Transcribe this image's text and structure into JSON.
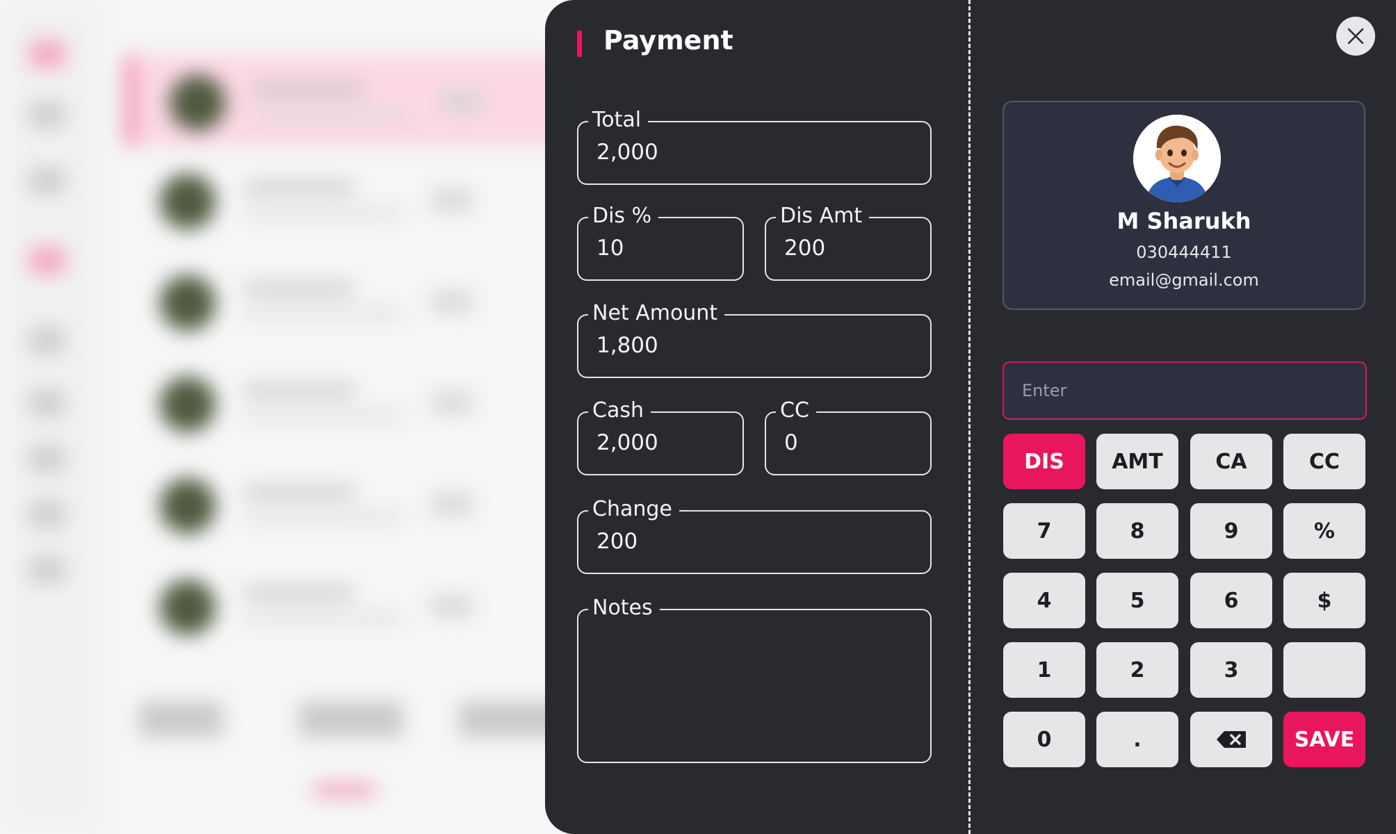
{
  "modal": {
    "title": "Payment",
    "close_icon": "close-icon"
  },
  "fields": {
    "total": {
      "label": "Total",
      "value": "2,000"
    },
    "dis_pct": {
      "label": "Dis %",
      "value": "10"
    },
    "dis_amt": {
      "label": "Dis Amt",
      "value": "200"
    },
    "net_amount": {
      "label": "Net Amount",
      "value": "1,800"
    },
    "cash": {
      "label": "Cash",
      "value": "2,000"
    },
    "cc": {
      "label": "CC",
      "value": "0"
    },
    "change": {
      "label": "Change",
      "value": "200"
    },
    "notes": {
      "label": "Notes",
      "value": ""
    }
  },
  "customer": {
    "name": "M Sharukh",
    "phone": "030444411",
    "email": "email@gmail.com",
    "avatar_icon": "avatar"
  },
  "keypad": {
    "input_placeholder": "Enter",
    "modes": [
      "DIS",
      "AMT",
      "CA",
      "CC"
    ],
    "row1": [
      "7",
      "8",
      "9",
      "%"
    ],
    "row2": [
      "4",
      "5",
      "6",
      "$"
    ],
    "row3": [
      "1",
      "2",
      "3",
      ""
    ],
    "row4": [
      "0",
      "."
    ],
    "backspace_icon": "backspace-icon",
    "save_label": "SAVE"
  },
  "colors": {
    "accent": "#e8175d",
    "panel": "#282a2f",
    "card": "#2e3040",
    "key": "#e6e6e8"
  }
}
